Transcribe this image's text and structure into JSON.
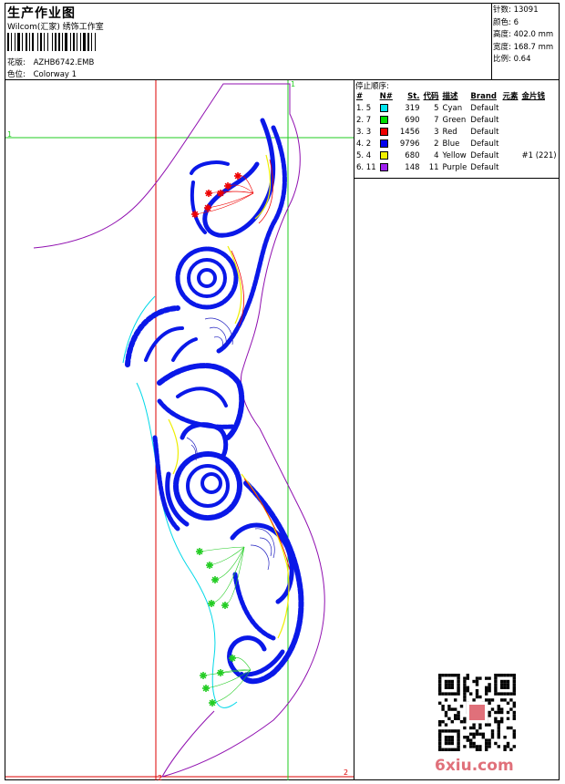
{
  "header": {
    "title": "生产作业图",
    "company": "Wilcom(汇家) 绣饰工作室",
    "design_label": "花版:",
    "design_value": "AZHB6742.EMB",
    "color_label": "色位:",
    "color_value": "Colorway 1"
  },
  "stats": {
    "stitches": "针数: 13091",
    "colors": "颜色: 6",
    "height": "高度: 402.0 mm",
    "width": "宽度: 168.7 mm",
    "scale": "比例: 0.64"
  },
  "sequence": {
    "heading": "停止顺序:",
    "columns": [
      "#",
      "N#",
      "St.",
      "代码",
      "描述",
      "Brand",
      "元素",
      "金片钱"
    ],
    "rows": [
      {
        "idx": "1. 5",
        "swatch": "#00e5ee",
        "st": "319",
        "code": "5",
        "desc": "Cyan",
        "brand": "Default",
        "extra": ""
      },
      {
        "idx": "2. 7",
        "swatch": "#00dd00",
        "st": "690",
        "code": "7",
        "desc": "Green",
        "brand": "Default",
        "extra": ""
      },
      {
        "idx": "3. 3",
        "swatch": "#ee0000",
        "st": "1456",
        "code": "3",
        "desc": "Red",
        "brand": "Default",
        "extra": ""
      },
      {
        "idx": "4. 2",
        "swatch": "#0000ee",
        "st": "9796",
        "code": "2",
        "desc": "Blue",
        "brand": "Default",
        "extra": ""
      },
      {
        "idx": "5. 4",
        "swatch": "#f0f000",
        "st": "680",
        "code": "4",
        "desc": "Yellow",
        "brand": "Default",
        "extra": "#1 (221)"
      },
      {
        "idx": "6. 11",
        "swatch": "#a020f0",
        "st": "148",
        "code": "11",
        "desc": "Purple",
        "brand": "Default",
        "extra": ""
      }
    ]
  },
  "guides": {
    "left_top_label": "1",
    "top_label": "1",
    "bottom_mid_label": "2",
    "bottom_right_label": "2"
  },
  "watermark": "6xiu.com",
  "colors": {
    "blue": "#0a18e8",
    "red": "#ee0000",
    "green": "#22cc22",
    "cyan": "#00d8e8",
    "yellow": "#eeee00",
    "purple": "#9010b0",
    "guide_red": "#dd0000",
    "guide_green": "#22cc22"
  }
}
